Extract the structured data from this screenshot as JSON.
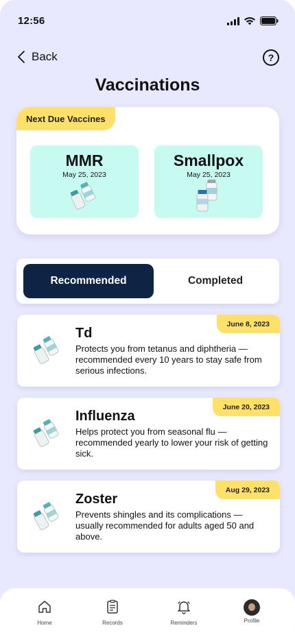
{
  "status": {
    "time": "12:56"
  },
  "header": {
    "back_label": "Back",
    "title": "Vaccinations"
  },
  "next_due": {
    "badge": "Next Due Vaccines",
    "items": [
      {
        "name": "MMR",
        "date": "May 25, 2023"
      },
      {
        "name": "Smallpox",
        "date": "May 25, 2023"
      }
    ]
  },
  "tabs": {
    "recommended": "Recommended",
    "completed": "Completed",
    "active": "Recommended"
  },
  "vaccines": [
    {
      "name": "Td",
      "date": "June 8, 2023",
      "description": "Protects you from tetanus and diphtheria — recommended every 10 years to stay safe from serious infections."
    },
    {
      "name": "Influenza",
      "date": "June 20, 2023",
      "description": "Helps protect you from seasonal flu — recommended yearly to lower your risk of getting sick."
    },
    {
      "name": "Zoster",
      "date": "Aug 29, 2023",
      "description": "Prevents shingles and its complications — usually recommended for adults aged 50 and above."
    }
  ],
  "nav": {
    "home": "Home",
    "records": "Records",
    "reminders": "Reminders",
    "profile": "Profile"
  },
  "colors": {
    "background": "#E8E8FF",
    "accent_yellow": "#FFE069",
    "due_tile": "#C7FBF2",
    "active_tab": "#0D2444"
  },
  "icons": [
    "signal-icon",
    "wifi-icon",
    "battery-icon",
    "back-chevron-icon",
    "help-icon",
    "vaccine-vial-icon",
    "home-icon",
    "records-icon",
    "bell-icon",
    "avatar"
  ]
}
